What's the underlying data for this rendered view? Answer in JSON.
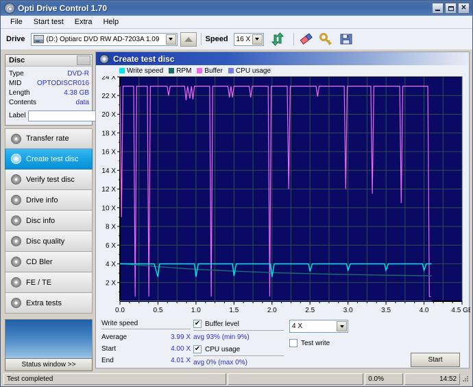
{
  "window": {
    "title": "Opti Drive Control 1.70",
    "icon": "cd-disc-icon",
    "buttons": {
      "minimize": "–",
      "maximize": "□",
      "close": "✕"
    }
  },
  "menu": {
    "items": [
      "File",
      "Start test",
      "Extra",
      "Help"
    ]
  },
  "toolbar": {
    "drive_label": "Drive",
    "drive_value": "(D:)   Optiarc DVD RW AD-7203A 1.09",
    "eject_icon": "eject-icon",
    "speed_label": "Speed",
    "speed_value": "16 X",
    "refresh_icon": "refresh-icon",
    "erase_icon": "eraser-icon",
    "key_icon": "key-icon",
    "save_icon": "save-icon"
  },
  "disc": {
    "header": "Disc",
    "rows": [
      {
        "key": "Type",
        "value": "DVD-R"
      },
      {
        "key": "MID",
        "value": "OPTODISCR016"
      },
      {
        "key": "Length",
        "value": "4.38 GB"
      },
      {
        "key": "Contents",
        "value": "data"
      }
    ],
    "label_key": "Label",
    "label_value": "",
    "label_placeholder": ""
  },
  "sidebar": {
    "items": [
      {
        "label": "Transfer rate",
        "icon": "disc-icon",
        "active": false
      },
      {
        "label": "Create test disc",
        "icon": "disc-icon",
        "active": true
      },
      {
        "label": "Verify test disc",
        "icon": "disc-icon",
        "active": false
      },
      {
        "label": "Drive info",
        "icon": "disc-icon",
        "active": false
      },
      {
        "label": "Disc info",
        "icon": "disc-icon",
        "active": false
      },
      {
        "label": "Disc quality",
        "icon": "disc-icon",
        "active": false
      },
      {
        "label": "CD Bler",
        "icon": "disc-icon",
        "active": false
      },
      {
        "label": "FE / TE",
        "icon": "disc-icon",
        "active": false
      },
      {
        "label": "Extra tests",
        "icon": "disc-icon",
        "active": false
      }
    ],
    "status_window_button": "Status window >>"
  },
  "content": {
    "title": "Create test disc",
    "icon": "disc-icon"
  },
  "stats": {
    "write_speed_header": "Write speed",
    "rows": [
      {
        "key": "Average",
        "value": "3.99 X"
      },
      {
        "key": "Start",
        "value": "4.00 X"
      },
      {
        "key": "End",
        "value": "4.01 X"
      }
    ],
    "buffer_level_label": "Buffer level",
    "buffer_level_checked": "✔",
    "buffer_note": "avg 93% (min 9%)",
    "cpu_usage_label": "CPU usage",
    "cpu_usage_checked": "✔",
    "cpu_note": "avg 0% (max 0%)",
    "write_speed_select": "4 X",
    "test_write_label": "Test write",
    "test_write_checked": "",
    "start_button": "Start"
  },
  "statusbar": {
    "message": "Test completed",
    "progress_percent": "0.0%",
    "progress_value": 0,
    "time": "14:52"
  },
  "colors": {
    "write_speed": "#00e5ee",
    "rpm": "#1d6b6b",
    "buffer": "#ee6aee",
    "cpu_usage": "#7a7aee",
    "plot_bg": "#0a0a64",
    "plot_grid": "#2f4f4f",
    "accent": "#2c2cd8",
    "titlebar": "#3f6aa8",
    "selection": "#16a3e6"
  },
  "chart_data": {
    "type": "line",
    "title": "Create test disc",
    "xlabel": "4.5 GB",
    "ylabel": "",
    "xlim": [
      0.0,
      4.5
    ],
    "ylim": [
      0,
      24
    ],
    "grid": true,
    "legend_position": "top",
    "xticks": [
      "0.0",
      "0.5",
      "1.0",
      "1.5",
      "2.0",
      "2.5",
      "3.0",
      "3.5",
      "4.0",
      "4.5 GB"
    ],
    "yticks": [
      "2 X",
      "4 X",
      "6 X",
      "8 X",
      "10 X",
      "12 X",
      "14 X",
      "16 X",
      "18 X",
      "20 X",
      "22 X",
      "24 X"
    ],
    "series": [
      {
        "name": "Write speed",
        "color": "#00e5ee",
        "x": [
          0.0,
          0.1,
          0.25,
          0.45,
          0.5,
          0.52,
          0.7,
          0.98,
          1.0,
          1.03,
          1.3,
          1.48,
          1.5,
          1.53,
          1.8,
          1.98,
          2.0,
          2.03,
          2.3,
          2.48,
          2.5,
          2.53,
          2.8,
          2.98,
          3.0,
          3.03,
          3.3,
          3.48,
          3.5,
          3.53,
          3.8,
          3.98,
          4.0,
          4.03,
          4.1
        ],
        "y": [
          4.0,
          4.0,
          4.0,
          4.0,
          2.6,
          4.0,
          4.0,
          4.0,
          2.6,
          4.0,
          4.0,
          4.0,
          2.7,
          4.0,
          4.0,
          4.0,
          2.6,
          4.0,
          4.0,
          4.0,
          3.2,
          4.0,
          4.0,
          4.0,
          3.3,
          4.0,
          4.0,
          4.0,
          3.3,
          4.0,
          4.0,
          4.0,
          3.3,
          4.0,
          4.0
        ]
      },
      {
        "name": "RPM",
        "color": "#1d6b6b",
        "x": [
          0.0,
          0.25,
          0.5,
          0.75,
          1.0,
          1.25,
          1.5,
          1.75,
          2.0,
          2.25,
          2.5,
          2.75,
          3.0,
          3.25,
          3.5,
          3.75,
          4.0,
          4.1
        ],
        "y": [
          4.05,
          3.85,
          3.7,
          3.55,
          3.42,
          3.32,
          3.22,
          3.14,
          3.06,
          3.0,
          2.95,
          2.9,
          2.86,
          2.82,
          2.79,
          2.76,
          2.73,
          2.72
        ]
      },
      {
        "name": "Buffer",
        "color": "#ee6aee",
        "x": [
          0.0,
          0.02,
          0.04,
          0.06,
          0.18,
          0.2,
          0.22,
          0.36,
          0.38,
          0.4,
          0.62,
          0.64,
          0.66,
          0.85,
          0.87,
          0.89,
          0.92,
          0.94,
          0.96,
          0.98,
          1.0,
          1.18,
          1.2,
          1.22,
          1.42,
          1.44,
          1.46,
          1.48,
          1.5,
          1.52,
          1.7,
          1.72,
          1.74,
          1.95,
          1.97,
          1.99,
          2.2,
          2.22,
          2.24,
          2.58,
          2.6,
          2.62,
          2.95,
          2.97,
          2.99,
          3.3,
          3.32,
          3.34,
          3.68,
          3.7,
          3.72,
          4.05,
          4.07,
          4.09
        ],
        "y": [
          23.0,
          9.0,
          23.0,
          23.0,
          23.0,
          0.5,
          23.0,
          23.0,
          0.5,
          23.0,
          23.0,
          22.0,
          23.0,
          23.0,
          21.5,
          23.0,
          21.7,
          23.0,
          21.6,
          23.0,
          23.0,
          23.0,
          0.5,
          23.0,
          23.0,
          21.8,
          23.0,
          21.8,
          23.0,
          23.0,
          23.0,
          21.8,
          23.0,
          23.0,
          0.5,
          23.0,
          23.0,
          12.0,
          23.0,
          23.0,
          21.9,
          23.0,
          23.0,
          12.0,
          23.0,
          23.0,
          11.5,
          23.0,
          23.0,
          10.5,
          23.0,
          23.0,
          0.5,
          0.5
        ]
      },
      {
        "name": "CPU usage",
        "color": "#7a7aee",
        "x": [
          0.0,
          4.1
        ],
        "y": [
          0.0,
          0.0
        ]
      }
    ],
    "legend": [
      {
        "label": "Write speed",
        "color": "#00e5ee"
      },
      {
        "label": "RPM",
        "color": "#1d6b6b"
      },
      {
        "label": "Buffer",
        "color": "#ee6aee"
      },
      {
        "label": "CPU usage",
        "color": "#7a7aee"
      }
    ]
  }
}
